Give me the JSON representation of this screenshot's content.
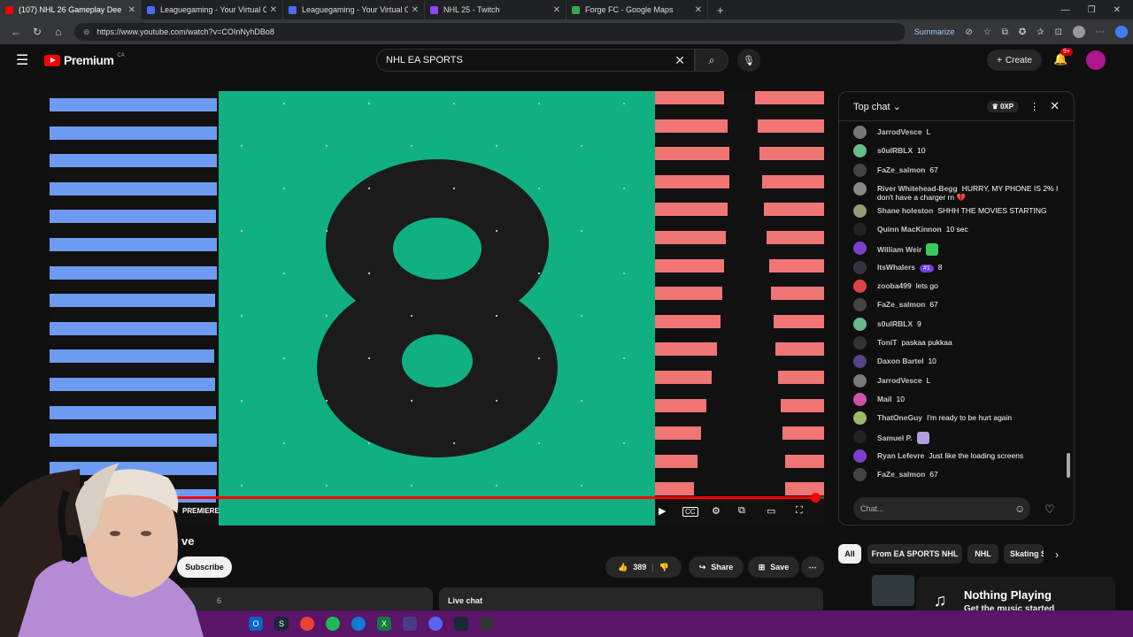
{
  "browser": {
    "tabs": [
      {
        "title": "(107) NHL 26 Gameplay Dee",
        "color": "#ff0000",
        "active": true
      },
      {
        "title": "Leaguegaming - Your Virtual Care",
        "color": "#4a6cf7",
        "active": false
      },
      {
        "title": "Leaguegaming - Your Virtual Care",
        "color": "#4a6cf7",
        "active": false
      },
      {
        "title": "NHL 25 - Twitch",
        "color": "#9146ff",
        "active": false
      },
      {
        "title": "Forge FC - Google Maps",
        "color": "#34a853",
        "active": false
      }
    ],
    "url": "https://www.youtube.com/watch?v=COInNyhDBo8",
    "summarize_label": "Summarize"
  },
  "youtube": {
    "logo_text": "Premium",
    "logo_region": "CA",
    "search_value": "NHL EA SPORTS",
    "create_label": "Create",
    "notif_count": "9+"
  },
  "video": {
    "premiere_label": "PREMIERE",
    "title_fragment": "ve",
    "subscribe_label": "Subscribe",
    "like_count": "389",
    "share_label": "Share",
    "save_label": "Save",
    "desc_fragment": "6",
    "live_chat_label": "Live chat",
    "progress_fraction": 0.99
  },
  "chat": {
    "header_label": "Top chat",
    "xp_label": "0XP",
    "input_placeholder": "Chat...",
    "messages": [
      {
        "user": "JarrodVesce",
        "text": "L",
        "color": "#777"
      },
      {
        "user": "s0ulRBLX",
        "text": "10",
        "color": "#6b8"
      },
      {
        "user": "FaZe_salmon",
        "text": "67",
        "color": "#444"
      },
      {
        "user": "River Whitehead-Begg",
        "text": "HURRY, MY PHONE IS 2% I don't have a charger rn 💔",
        "color": "#888"
      },
      {
        "user": "Shane holeston",
        "text": "SHHH THE MOVIES STARTING",
        "color": "#997"
      },
      {
        "user": "Quinn MacKinnon",
        "text": "10 sec",
        "color": "#222"
      },
      {
        "user": "William Weir",
        "text": "",
        "color": "#7b3fcf"
      },
      {
        "user": "ItsWhalers",
        "text": "8",
        "badge": "#1",
        "color": "#334"
      },
      {
        "user": "zooba499",
        "text": "lets go",
        "color": "#d44"
      },
      {
        "user": "FaZe_salmon",
        "text": "67",
        "color": "#444"
      },
      {
        "user": "s0ulRBLX",
        "text": "9",
        "color": "#6b8"
      },
      {
        "user": "ToniT",
        "text": "paskaa pukkaa",
        "color": "#333"
      },
      {
        "user": "Daxon Bartel",
        "text": "10",
        "color": "#548"
      },
      {
        "user": "JarrodVesce",
        "text": "L",
        "color": "#777"
      },
      {
        "user": "Mail",
        "text": "10",
        "color": "#c5a"
      },
      {
        "user": "ThatOneGuy",
        "text": "I'm ready to be hurt again",
        "color": "#9b6"
      },
      {
        "user": "Samuel P.",
        "text": "",
        "color": "#222"
      },
      {
        "user": "Ryan Lefevre",
        "text": "Just like the loading screens",
        "color": "#7b3fcf"
      },
      {
        "user": "FaZe_salmon",
        "text": "67",
        "color": "#444"
      }
    ]
  },
  "chips": [
    "All",
    "From EA SPORTS NHL",
    "NHL",
    "Skating S"
  ],
  "now_playing": {
    "title": "Nothing Playing",
    "subtitle": "Get the music started"
  },
  "colors": {
    "accent_red": "#ff0000",
    "video_green": "#10b083",
    "stripe_blue": "#6d9bf1",
    "stripe_red": "#f07575",
    "taskbar_purple": "#5a1468"
  }
}
